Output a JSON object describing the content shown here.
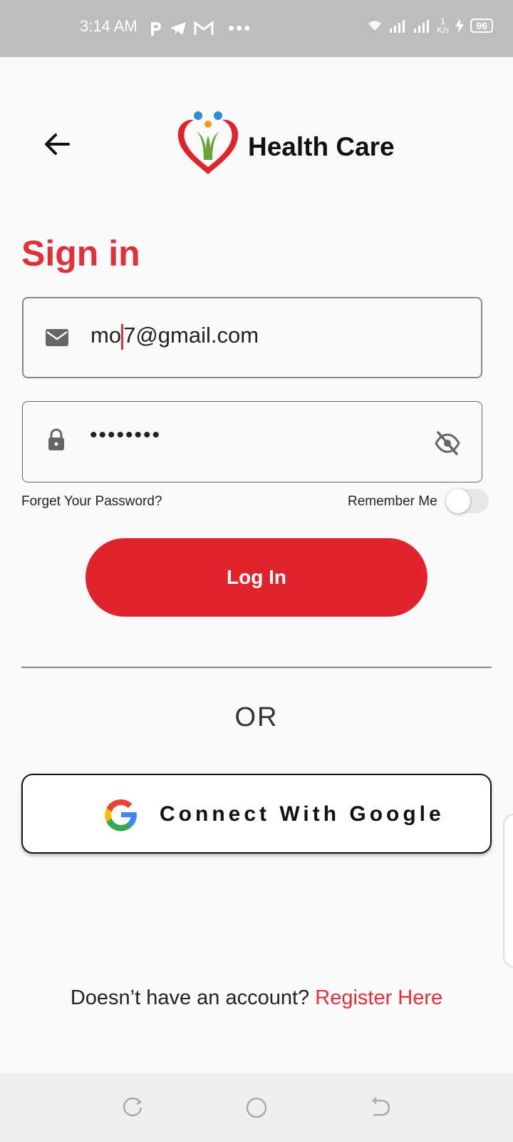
{
  "status_bar": {
    "time": "3:14 AM",
    "network_speed": "1\nK/s",
    "battery": "96"
  },
  "header": {
    "brand": "Health Care"
  },
  "form": {
    "title": "Sign in",
    "email_value_before_caret": "mo",
    "email_value_after_caret": "7@gmail.com",
    "password_masked": "••••••••",
    "forget_password": "Forget Your Password?",
    "remember_me": "Remember Me",
    "remember_me_on": false,
    "login_button": "Log In",
    "or_text": "OR",
    "google_button": "Connect With Google"
  },
  "footer": {
    "no_account": "Doesn’t have an account? ",
    "register_link": "Register Here"
  },
  "colors": {
    "accent": "#e0303a",
    "button": "#e0232c"
  }
}
